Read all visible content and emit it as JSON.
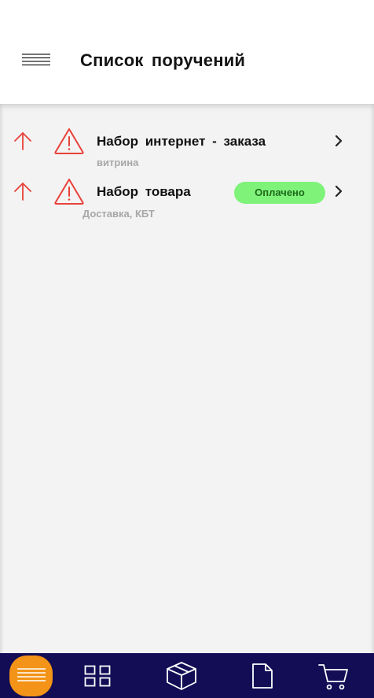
{
  "header": {
    "title": "Список поручений",
    "menu_icon": "hamburger-menu-icon"
  },
  "tasks": [
    {
      "title": "Набор интернет - заказа",
      "subtitle": "витрина",
      "priority_icon": "arrow-up-icon",
      "warning_icon": "warning-triangle-icon",
      "status": ""
    },
    {
      "title": "Набор товара",
      "subtitle": "Доставка, КБТ",
      "priority_icon": "arrow-up-icon",
      "warning_icon": "warning-triangle-icon",
      "status": "Оплачено"
    }
  ],
  "bottom_nav": {
    "items": [
      {
        "icon": "list-icon",
        "active": true
      },
      {
        "icon": "grid-icon",
        "active": false
      },
      {
        "icon": "package-icon",
        "active": false
      },
      {
        "icon": "document-icon",
        "active": false
      },
      {
        "icon": "cart-icon",
        "active": false
      }
    ]
  },
  "colors": {
    "accent_red": "#e8413a",
    "status_green": "#7ff27a",
    "nav_bg": "#120d55",
    "nav_active": "#f39317",
    "content_bg": "#f3f3f3"
  }
}
